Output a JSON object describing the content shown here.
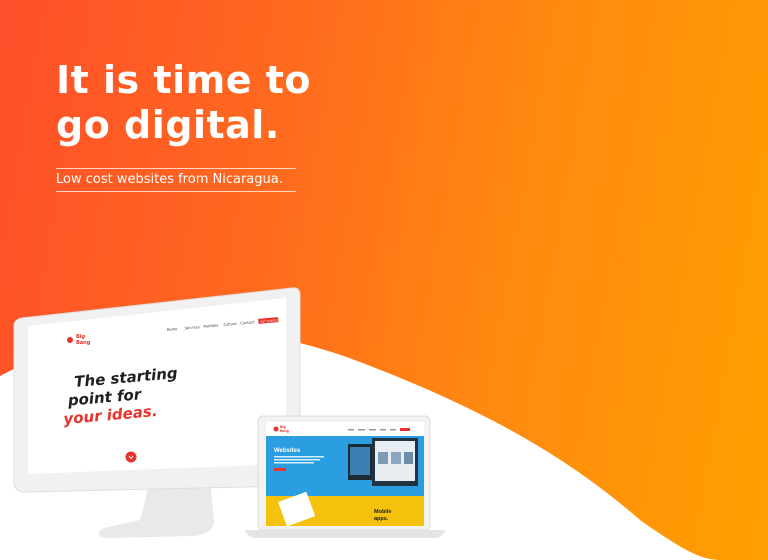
{
  "hero": {
    "headline_line1": "It is time to",
    "headline_line2": "go digital.",
    "tagline": "Low cost websites from Nicaragua."
  },
  "monitor_site": {
    "logo_line1": "Big",
    "logo_line2": "Bang",
    "nav": [
      "Home",
      "Services",
      "Portfolio",
      "Culture",
      "Contact"
    ],
    "cta": "GET STARTED",
    "hero_line1": "The starting",
    "hero_line2": "point for",
    "hero_line3": "your ideas."
  },
  "laptop_site": {
    "logo_line1": "Big",
    "logo_line2": "Bang",
    "section_title": "Websites",
    "mobile_line1": "Mobile",
    "mobile_line2": "apps."
  },
  "colors": {
    "gradient_start": "#ff4e2a",
    "gradient_end": "#ffa000",
    "brand_red": "#e8322c",
    "laptop_blue": "#2a9ee0",
    "laptop_yellow": "#f4c20d"
  }
}
